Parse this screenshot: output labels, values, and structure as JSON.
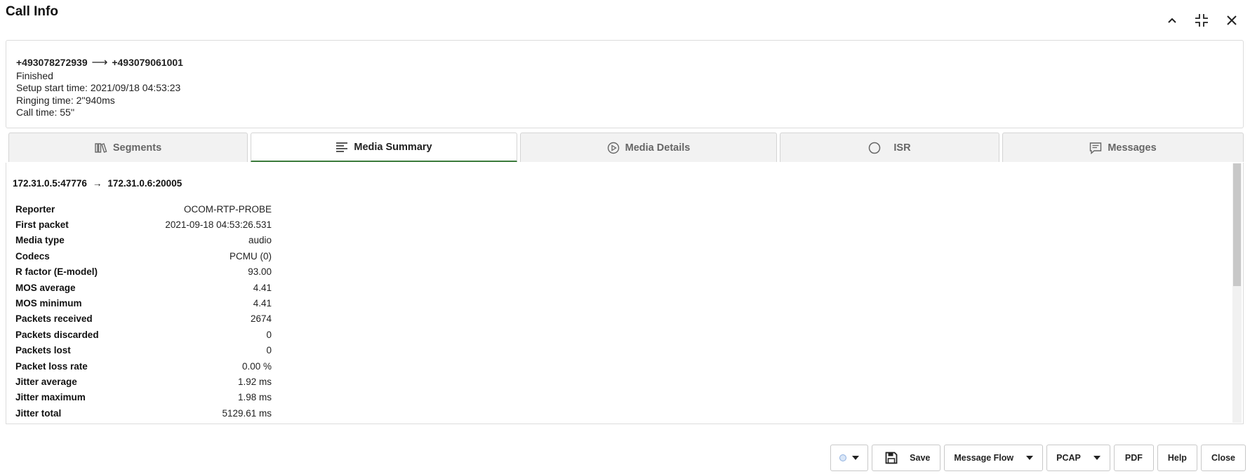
{
  "window": {
    "title": "Call Info",
    "controls": [
      "collapse-icon",
      "minimize-icon",
      "close-icon"
    ]
  },
  "call": {
    "from": "+493078272939",
    "arrow": "⟶",
    "to": "+493079061001",
    "status": "Finished",
    "setup_start": "Setup start time: 2021/09/18 04:53:23",
    "ringing": "Ringing time: 2''940ms",
    "call_time": "Call time: 55''"
  },
  "tabs": [
    {
      "label": "Segments",
      "icon": "segments-icon"
    },
    {
      "label": "Media Summary",
      "icon": "list-lines-icon",
      "active": true
    },
    {
      "label": "Media Details",
      "icon": "play-circle-icon"
    },
    {
      "label": "ISR",
      "icon": "circle-icon"
    },
    {
      "label": "Messages",
      "icon": "message-icon"
    }
  ],
  "media": {
    "source": "172.31.0.5:47776",
    "arrow": "→",
    "dest": "172.31.0.6:20005",
    "rows": [
      {
        "label": "Reporter",
        "value": "OCOM-RTP-PROBE"
      },
      {
        "label": "First packet",
        "value": "2021-09-18 04:53:26.531"
      },
      {
        "label": "Media type",
        "value": "audio"
      },
      {
        "label": "Codecs",
        "value": "PCMU (0)"
      },
      {
        "label": "R factor (E-model)",
        "value": "93.00"
      },
      {
        "label": "MOS average",
        "value": "4.41"
      },
      {
        "label": "MOS minimum",
        "value": "4.41"
      },
      {
        "label": "Packets received",
        "value": "2674"
      },
      {
        "label": "Packets discarded",
        "value": "0"
      },
      {
        "label": "Packets lost",
        "value": "0"
      },
      {
        "label": "Packet loss rate",
        "value": "0.00 %"
      },
      {
        "label": "Jitter average",
        "value": "1.92 ms"
      },
      {
        "label": "Jitter maximum",
        "value": "1.98 ms"
      },
      {
        "label": "Jitter total",
        "value": "5129.61 ms"
      }
    ]
  },
  "footer": {
    "save": "Save",
    "message_flow": "Message Flow",
    "pcap": "PCAP",
    "pdf": "PDF",
    "help": "Help",
    "close": "Close"
  },
  "colors": {
    "active_tab_underline": "#3a7a3a",
    "tab_bg": "#f2f2f2"
  }
}
